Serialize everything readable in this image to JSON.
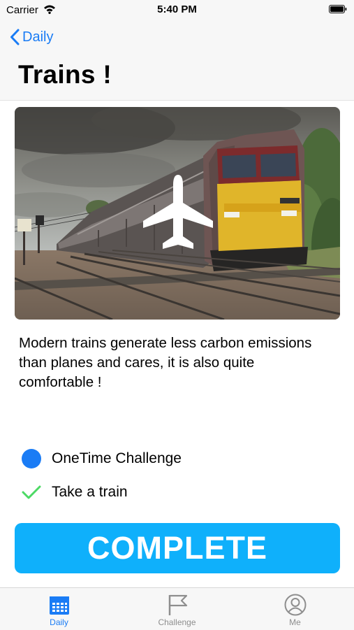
{
  "status_bar": {
    "carrier": "Carrier",
    "time": "5:40 PM"
  },
  "nav": {
    "back_label": "Daily",
    "title": "Trains !"
  },
  "hero": {
    "image_subject": "freight train on railway tracks",
    "overlay_icon": "airplane-icon"
  },
  "description": "Modern trains generate less carbon emissions than planes and cares, it is also quite comfortable !",
  "challenge": {
    "type_label": "OneTime Challenge",
    "task_label": "Take a train"
  },
  "complete_button": {
    "label": "COMPLETE"
  },
  "tabs": [
    {
      "label": "Daily",
      "icon": "calendar-icon",
      "selected": true
    },
    {
      "label": "Challenge",
      "icon": "flag-icon",
      "selected": false
    },
    {
      "label": "Me",
      "icon": "profile-icon",
      "selected": false
    }
  ],
  "colors": {
    "accent": "#1a7cf5",
    "button": "#0fb0fb",
    "check": "#4cd964",
    "tab_inactive": "#8e8e8e"
  }
}
